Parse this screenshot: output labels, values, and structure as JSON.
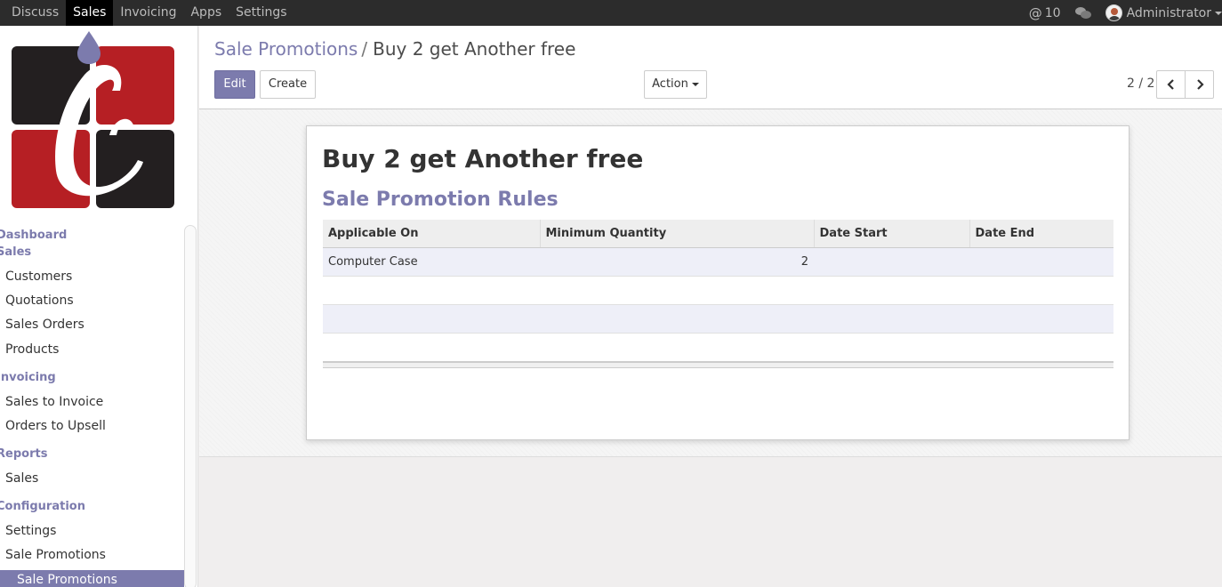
{
  "topbar": {
    "menu": [
      "Discuss",
      "Sales",
      "Invoicing",
      "Apps",
      "Settings"
    ],
    "active_index": 1,
    "mentions_count": "10",
    "user": "Administrator"
  },
  "sidebar": {
    "sections": [
      {
        "label": "Dashboard"
      },
      {
        "label": "Sales",
        "items": [
          "Customers",
          "Quotations",
          "Sales Orders",
          "Products"
        ]
      },
      {
        "label": "Invoicing",
        "items": [
          "Sales to Invoice",
          "Orders to Upsell"
        ]
      },
      {
        "label": "Reports",
        "items": [
          "Sales"
        ]
      },
      {
        "label": "Configuration",
        "items": [
          "Settings",
          "Sale Promotions"
        ]
      }
    ],
    "active_item": "Sale Promotions"
  },
  "control": {
    "breadcrumb_parent": "Sale Promotions",
    "breadcrumb_separator": "/",
    "breadcrumb_current": "Buy 2 get Another free",
    "edit_label": "Edit",
    "create_label": "Create",
    "action_label": "Action",
    "pager": "2 / 2"
  },
  "form": {
    "title": "Buy 2 get Another free",
    "section_title": "Sale Promotion Rules",
    "columns": [
      "Applicable On",
      "Minimum Quantity",
      "Date Start",
      "Date End"
    ],
    "rows": [
      {
        "applicable_on": "Computer Case",
        "minimum_quantity": "2",
        "date_start": "",
        "date_end": ""
      }
    ]
  },
  "colors": {
    "accent": "#7c7bad",
    "topbar": "#2c2c2c",
    "logo_red": "#b61f24",
    "logo_dark": "#231f20"
  }
}
